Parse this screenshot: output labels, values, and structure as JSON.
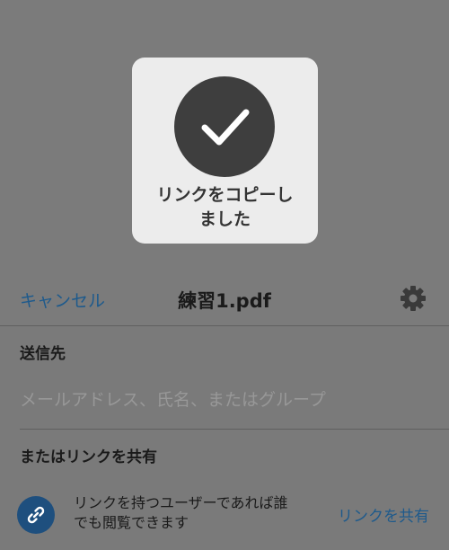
{
  "toast": {
    "message": "リンクをコピーし\nました"
  },
  "nav": {
    "cancel_label": "キャンセル",
    "title": "練習1.pdf"
  },
  "recipients": {
    "label": "送信先",
    "placeholder": "メールアドレス、氏名、またはグループ",
    "value": ""
  },
  "share_link": {
    "label": "またはリンクを共有",
    "description": "リンクを持つユーザーであれば誰\nでも閲覧できます",
    "button_label": "リンクを共有"
  },
  "colors": {
    "accent": "#1e5a8c",
    "overlay": "#7b7b7b",
    "toast_bg": "#ececec",
    "check_circle": "#3e3e3e",
    "link_icon_bg": "#1e4f7e"
  },
  "icons": {
    "toast": "checkmark-icon",
    "settings": "gear-icon",
    "share": "link-icon"
  }
}
